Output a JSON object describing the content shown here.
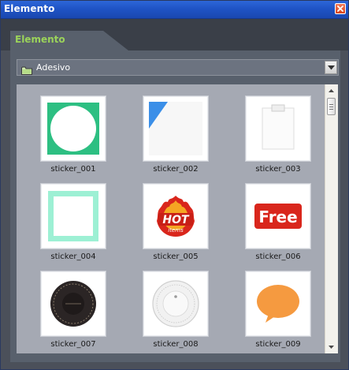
{
  "window": {
    "title": "Elemento",
    "close_icon": "close-icon"
  },
  "tab": {
    "label": "Elemento"
  },
  "category_select": {
    "value": "Adesivo",
    "icon": "folder-icon"
  },
  "stickers": [
    {
      "label": "sticker_001"
    },
    {
      "label": "sticker_002"
    },
    {
      "label": "sticker_003"
    },
    {
      "label": "sticker_004"
    },
    {
      "label": "sticker_005"
    },
    {
      "label": "sticker_006"
    },
    {
      "label": "sticker_007"
    },
    {
      "label": "sticker_008"
    },
    {
      "label": "sticker_009"
    }
  ],
  "sticker_005_text": {
    "line1": "HOT",
    "line2": "items"
  },
  "sticker_006_text": "Free",
  "colors": {
    "titlebar": "#2059cf",
    "tab_label": "#9bd35a",
    "panel": "#58606c",
    "grid_bg": "#a5a9b3",
    "green_circle": "#2dbf82",
    "blue_triangle": "#3b8fe8",
    "mint_frame": "#9df0d4",
    "hot_red": "#d9261c",
    "free_red": "#d9261c",
    "dark_badge": "#2b2525",
    "orange_bubble": "#f59a40"
  }
}
